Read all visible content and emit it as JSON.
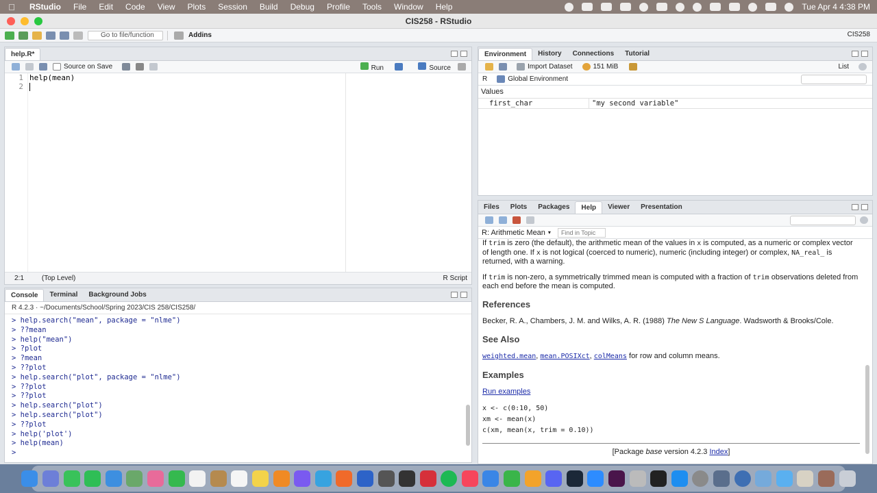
{
  "menubar": {
    "app": "RStudio",
    "items": [
      "File",
      "Edit",
      "Code",
      "View",
      "Plots",
      "Session",
      "Build",
      "Debug",
      "Profile",
      "Tools",
      "Window",
      "Help"
    ],
    "clock": "Tue Apr 4  4:38 PM"
  },
  "window": {
    "title": "CIS258 - RStudio",
    "goto_placeholder": "Go to file/function",
    "addins": "Addins",
    "project": "CIS258"
  },
  "editor": {
    "tab": "help.R*",
    "source_on_save": "Source on Save",
    "run": "Run",
    "source": "Source",
    "line_numbers": [
      "1",
      "2"
    ],
    "lines": [
      "help(mean)",
      ""
    ],
    "cursor_pos": "2:1",
    "scope": "(Top Level)",
    "filetype": "R Script"
  },
  "console": {
    "tabs": [
      "Console",
      "Terminal",
      "Background Jobs"
    ],
    "r_version": "R 4.2.3",
    "path": "~/Documents/School/Spring 2023/CIS 258/CIS258/",
    "lines": [
      "> help.search(\"mean\", package = \"nlme\")",
      "> ??mean",
      "> help(\"mean\")",
      "> ?plot",
      "> ?mean",
      "> ??plot",
      "> help.search(\"plot\", package = \"nlme\")",
      "> ??plot",
      "> ??plot",
      "> help.search(\"plot\")",
      "> help.search(\"plot\")",
      "> ??plot",
      "> help('plot')",
      "> help(mean)",
      "> "
    ]
  },
  "environment": {
    "tabs": [
      "Environment",
      "History",
      "Connections",
      "Tutorial"
    ],
    "import_dataset": "Import Dataset",
    "memory": "151 MiB",
    "view_mode": "List",
    "language": "R",
    "scope": "Global Environment",
    "section": "Values",
    "values": [
      {
        "name": "first_char",
        "value": "\"my second variable\""
      }
    ]
  },
  "help": {
    "tabs": [
      "Files",
      "Plots",
      "Packages",
      "Help",
      "Viewer",
      "Presentation"
    ],
    "topic": "R: Arithmetic Mean",
    "find_placeholder": "Find in Topic",
    "p1_a": "If ",
    "p1_code1": "trim",
    "p1_b": " is zero (the default), the arithmetic mean of the values in ",
    "p1_code2": "x",
    "p1_c": " is computed, as a numeric or complex vector of length one. If ",
    "p1_code3": "x",
    "p1_d": " is not logical (coerced to numeric), numeric (including integer) or complex, ",
    "p1_code4": "NA_real_",
    "p1_e": " is returned, with a warning.",
    "p2_a": "If ",
    "p2_code1": "trim",
    "p2_b": " is non-zero, a symmetrically trimmed mean is computed with a fraction of ",
    "p2_code2": "trim",
    "p2_c": " observations deleted from each end before the mean is computed.",
    "references_heading": "References",
    "reference_a": "Becker, R. A., Chambers, J. M. and Wilks, A. R. (1988) ",
    "reference_title": "The New S Language",
    "reference_b": ". Wadsworth & Brooks/Cole.",
    "see_also_heading": "See Also",
    "see_also_link1": "weighted.mean",
    "see_also_link2": "mean.POSIXct",
    "see_also_link3": "colMeans",
    "see_also_tail": " for row and column means.",
    "examples_heading": "Examples",
    "run_examples": "Run examples",
    "examples": [
      "x <- c(0:10, 50)",
      "xm <- mean(x)",
      "c(xm, mean(x, trim = 0.10))"
    ],
    "footer_a": "[Package ",
    "footer_pkg": "base",
    "footer_b": " version 4.2.3 ",
    "footer_index": "Index",
    "footer_c": "]"
  },
  "colors": {
    "menubar": "#8a7d77",
    "close": "#fe5f57",
    "minimize": "#febc2e",
    "maximize": "#28c840",
    "console_text": "#1e2a91",
    "link": "#1a2aa8"
  }
}
